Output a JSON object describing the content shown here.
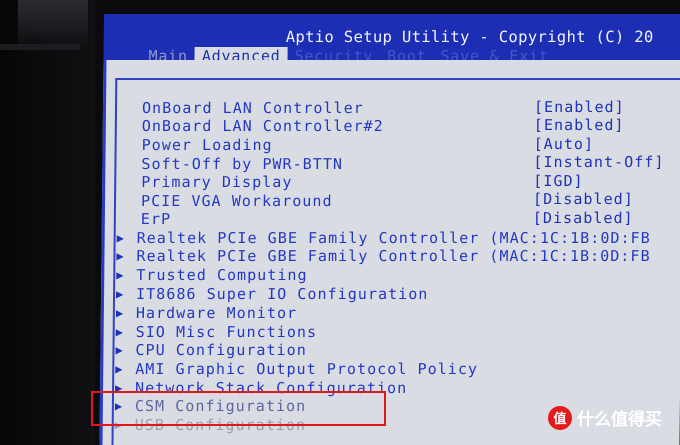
{
  "header": {
    "title": "Aptio Setup Utility - Copyright (C) 20"
  },
  "tabs": [
    {
      "label": "Main"
    },
    {
      "label": "Advanced"
    },
    {
      "label": "Security"
    },
    {
      "label": "Boot"
    },
    {
      "label": "Save & Exit"
    }
  ],
  "settings": [
    {
      "label": "OnBoard LAN Controller",
      "value": "[Enabled]"
    },
    {
      "label": "OnBoard LAN Controller#2",
      "value": "[Enabled]"
    },
    {
      "label": "Power Loading",
      "value": "[Auto]"
    },
    {
      "label": "Soft-Off by PWR-BTTN",
      "value": "[Instant-Off]"
    },
    {
      "label": "Primary Display",
      "value": "[IGD]"
    },
    {
      "label": "PCIE VGA Workaround",
      "value": "[Disabled]"
    },
    {
      "label": "ErP",
      "value": "[Disabled]"
    }
  ],
  "submenus": [
    {
      "label": "Realtek PCIe GBE Family Controller (MAC:1C:1B:0D:FB"
    },
    {
      "label": "Realtek PCIe GBE Family Controller (MAC:1C:1B:0D:FB"
    },
    {
      "label": "Trusted Computing"
    },
    {
      "label": "IT8686 Super IO Configuration"
    },
    {
      "label": "Hardware Monitor"
    },
    {
      "label": "SIO Misc Functions"
    },
    {
      "label": "CPU Configuration"
    },
    {
      "label": "AMI Graphic Output Protocol Policy"
    },
    {
      "label": "Network Stack Configuration"
    },
    {
      "label": "CSM Configuration"
    },
    {
      "label": "USB Configuration"
    }
  ],
  "arrow_glyph": "▶",
  "watermark": {
    "logo_text": "值",
    "text": "什么值得买"
  },
  "colors": {
    "header_blue": "#1c2fb4",
    "body_gray": "#d9dce2",
    "text_blue": "#1d32b8",
    "highlight_red": "#e0181c"
  }
}
